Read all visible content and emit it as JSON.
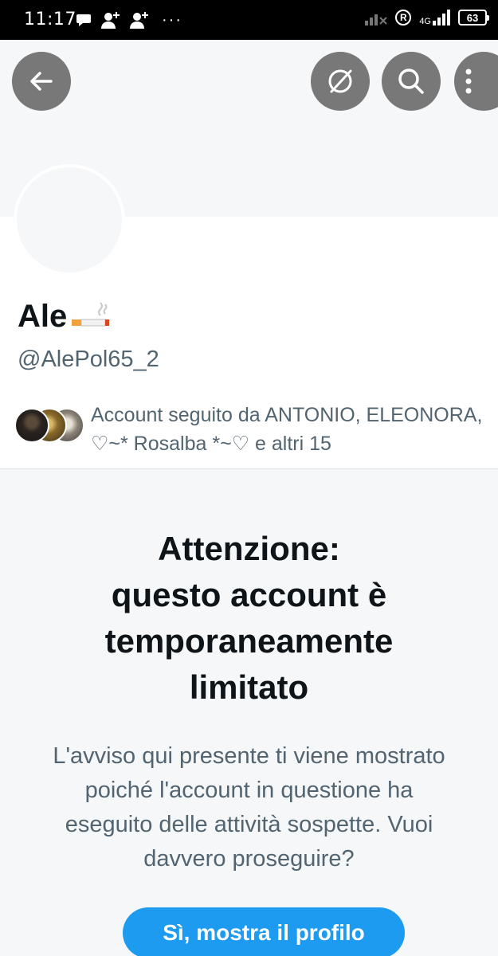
{
  "status_bar": {
    "time": "11:17",
    "icons_left": [
      "chat-bubble-icon",
      "person-add-icon",
      "person-add-icon"
    ],
    "more": "···",
    "registered": "R",
    "network": "4G",
    "battery": "63"
  },
  "header": {
    "buttons": [
      "back-arrow-icon",
      "unfollow-icon",
      "search-icon",
      "more-vertical-icon"
    ]
  },
  "profile": {
    "name": "Ale",
    "name_emoji": "cigarette",
    "handle": "@AlePol65_2",
    "followed_by": "Account seguito da ANTONIO, ELEONORA, ♡~* Rosalba *~♡ e altri 15"
  },
  "notice": {
    "title_line1": "Attenzione:",
    "title_line2": "questo account è",
    "title_line3": "temporaneamente",
    "title_line4": "limitato",
    "body": "L'avviso qui presente ti viene mostrato poiché l'account in questione ha eseguito delle attività sospette. Vuoi davvero proseguire?",
    "button": "Sì, mostra il profilo"
  },
  "colors": {
    "accent": "#1d9bf0",
    "icon_button_bg": "#787878",
    "secondary_text": "#536471",
    "notice_bg": "#f5f7f8"
  }
}
